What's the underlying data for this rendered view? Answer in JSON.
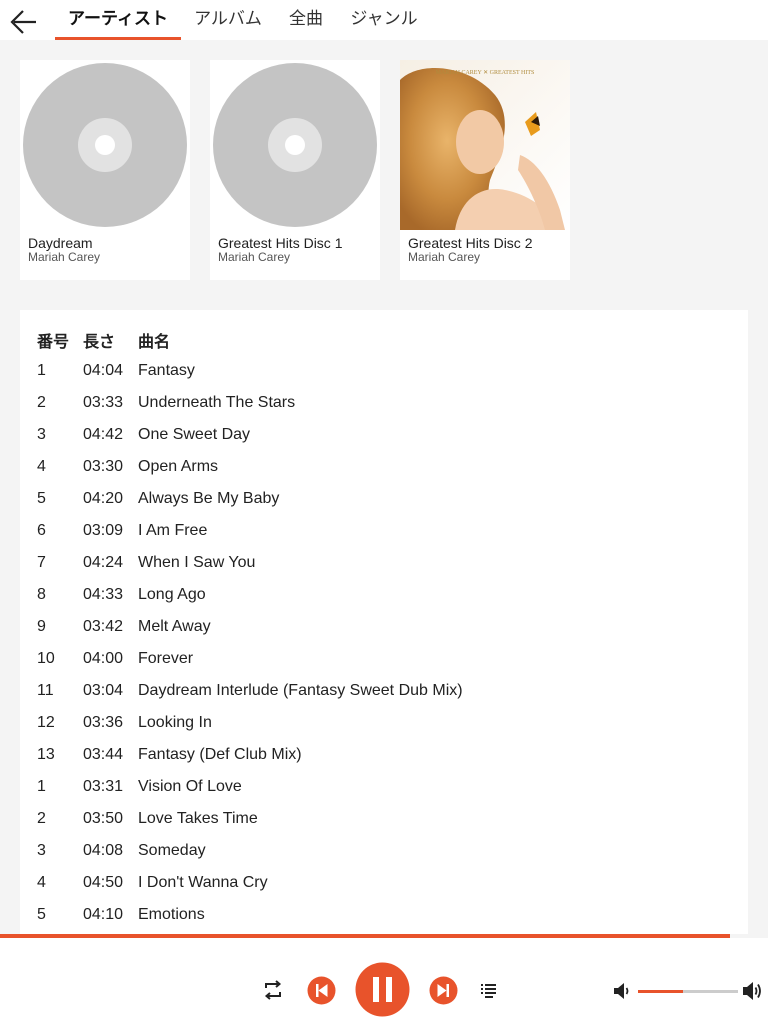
{
  "tabs": [
    {
      "label": "アーティスト",
      "active": true
    },
    {
      "label": "アルバム",
      "active": false
    },
    {
      "label": "全曲",
      "active": false
    },
    {
      "label": "ジャンル",
      "active": false
    }
  ],
  "albums": [
    {
      "title": "Daydream",
      "artist": "Mariah Carey",
      "cover": "disc-placeholder"
    },
    {
      "title": "Greatest Hits Disc 1",
      "artist": "Mariah Carey",
      "cover": "disc-placeholder"
    },
    {
      "title": "Greatest Hits Disc 2",
      "artist": "Mariah Carey",
      "cover": "album-art",
      "cover_text": "MARIAH CAREY ✕ GREATEST HITS"
    }
  ],
  "track_table": {
    "headers": {
      "number": "番号",
      "length": "長さ",
      "name": "曲名"
    },
    "rows": [
      {
        "number": "1",
        "length": "04:04",
        "name": "Fantasy"
      },
      {
        "number": "2",
        "length": "03:33",
        "name": "Underneath The Stars"
      },
      {
        "number": "3",
        "length": "04:42",
        "name": "One Sweet Day"
      },
      {
        "number": "4",
        "length": "03:30",
        "name": "Open Arms"
      },
      {
        "number": "5",
        "length": "04:20",
        "name": "Always Be My Baby"
      },
      {
        "number": "6",
        "length": "03:09",
        "name": "I Am Free"
      },
      {
        "number": "7",
        "length": "04:24",
        "name": "When I Saw You"
      },
      {
        "number": "8",
        "length": "04:33",
        "name": "Long Ago"
      },
      {
        "number": "9",
        "length": "03:42",
        "name": "Melt Away"
      },
      {
        "number": "10",
        "length": "04:00",
        "name": "Forever"
      },
      {
        "number": "11",
        "length": "03:04",
        "name": "Daydream Interlude (Fantasy Sweet Dub Mix)"
      },
      {
        "number": "12",
        "length": "03:36",
        "name": "Looking In"
      },
      {
        "number": "13",
        "length": "03:44",
        "name": "Fantasy (Def Club Mix)"
      },
      {
        "number": "1",
        "length": "03:31",
        "name": "Vision Of Love"
      },
      {
        "number": "2",
        "length": "03:50",
        "name": "Love Takes Time"
      },
      {
        "number": "3",
        "length": "04:08",
        "name": "Someday"
      },
      {
        "number": "4",
        "length": "04:50",
        "name": "I Don't Wanna Cry"
      },
      {
        "number": "5",
        "length": "04:10",
        "name": "Emotions"
      }
    ]
  },
  "player": {
    "progress": 0.95,
    "volume": 0.45,
    "state": "playing",
    "controls": [
      "repeat-icon",
      "previous-icon",
      "pause-icon",
      "next-icon",
      "playlist-icon",
      "volume-icon",
      "volume-max-icon"
    ]
  },
  "colors": {
    "accent": "#e8532b",
    "background": "#f4f4f4",
    "placeholder_disc": "#c4c4c4"
  }
}
